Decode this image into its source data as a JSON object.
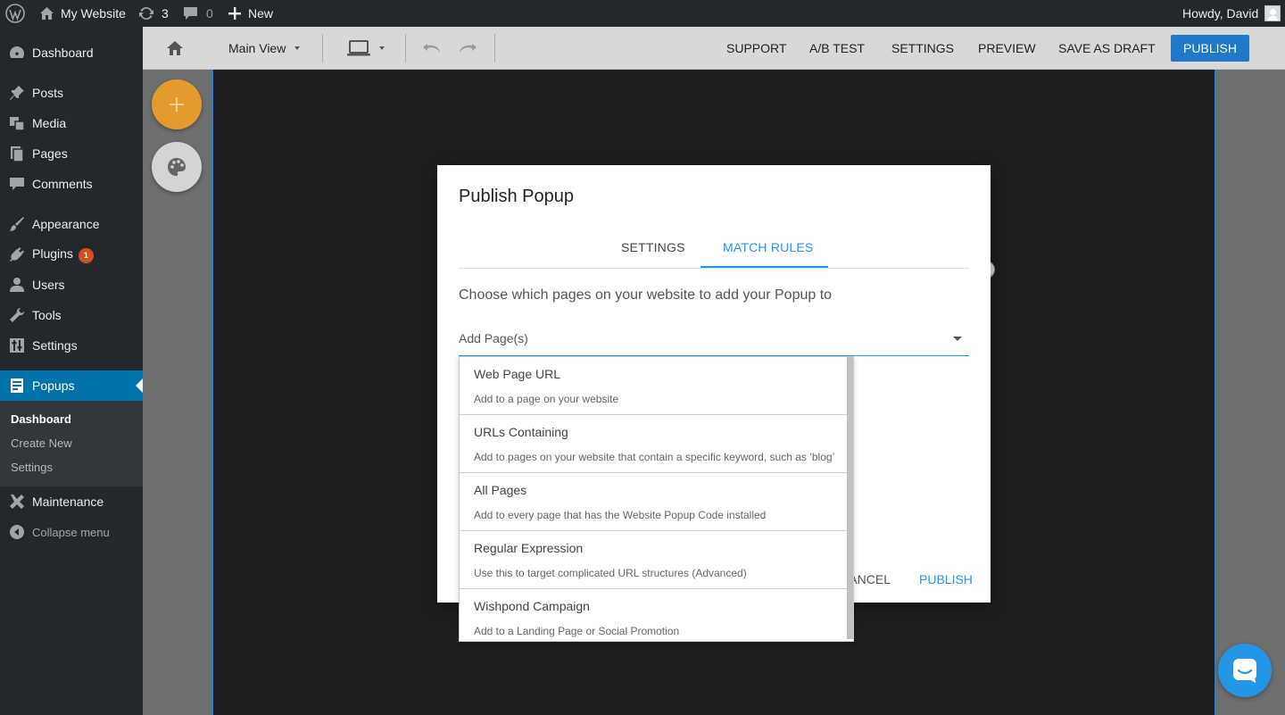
{
  "adminbar": {
    "site_name": "My Website",
    "updates_count": "3",
    "comments_count": "0",
    "new_label": "New",
    "greeting": "Howdy, David"
  },
  "sidebar": {
    "items": [
      {
        "label": "Dashboard",
        "icon": "dashboard-icon"
      },
      {
        "label": "Posts",
        "icon": "pin-icon"
      },
      {
        "label": "Media",
        "icon": "media-icon"
      },
      {
        "label": "Pages",
        "icon": "pages-icon"
      },
      {
        "label": "Comments",
        "icon": "comment-icon"
      },
      {
        "label": "Appearance",
        "icon": "brush-icon"
      },
      {
        "label": "Plugins",
        "icon": "plugin-icon",
        "badge": "1"
      },
      {
        "label": "Users",
        "icon": "user-icon"
      },
      {
        "label": "Tools",
        "icon": "wrench-icon"
      },
      {
        "label": "Settings",
        "icon": "sliders-icon"
      },
      {
        "label": "Popups",
        "icon": "popup-icon",
        "active": true
      },
      {
        "label": "Maintenance",
        "icon": "tools-icon"
      },
      {
        "label": "Collapse menu",
        "icon": "collapse-icon"
      }
    ],
    "submenu": [
      "Dashboard",
      "Create New",
      "Settings"
    ]
  },
  "toolbar": {
    "view_label": "Main View",
    "links": [
      "SUPPORT",
      "A/B TEST",
      "SETTINGS",
      "PREVIEW",
      "SAVE AS DRAFT"
    ],
    "publish_label": "PUBLISH"
  },
  "modal": {
    "title": "Publish Popup",
    "tabs": [
      "SETTINGS",
      "MATCH RULES"
    ],
    "active_tab": "MATCH RULES",
    "description": "Choose which pages on your website to add your Popup to",
    "select_placeholder": "Add Page(s)",
    "cancel_label": "CANCEL",
    "publish_label": "PUBLISH"
  },
  "dropdown": {
    "options": [
      {
        "title": "Web Page URL",
        "subtitle": "Add to a page on your website"
      },
      {
        "title": "URLs Containing",
        "subtitle": "Add to pages on your website that contain a specific keyword, such as ‘blog’"
      },
      {
        "title": "All Pages",
        "subtitle": "Add to every page that has the Website Popup Code installed"
      },
      {
        "title": "Regular Expression",
        "subtitle": "Use this to target complicated URL structures (Advanced)"
      },
      {
        "title": "Wishpond Campaign",
        "subtitle": "Add to a Landing Page or Social Promotion"
      }
    ]
  },
  "colors": {
    "wp_dark": "#23282d",
    "wp_active": "#0073aa",
    "accent": "#2196f3",
    "fab_add": "#e39b2e",
    "chat": "#2396e6"
  }
}
